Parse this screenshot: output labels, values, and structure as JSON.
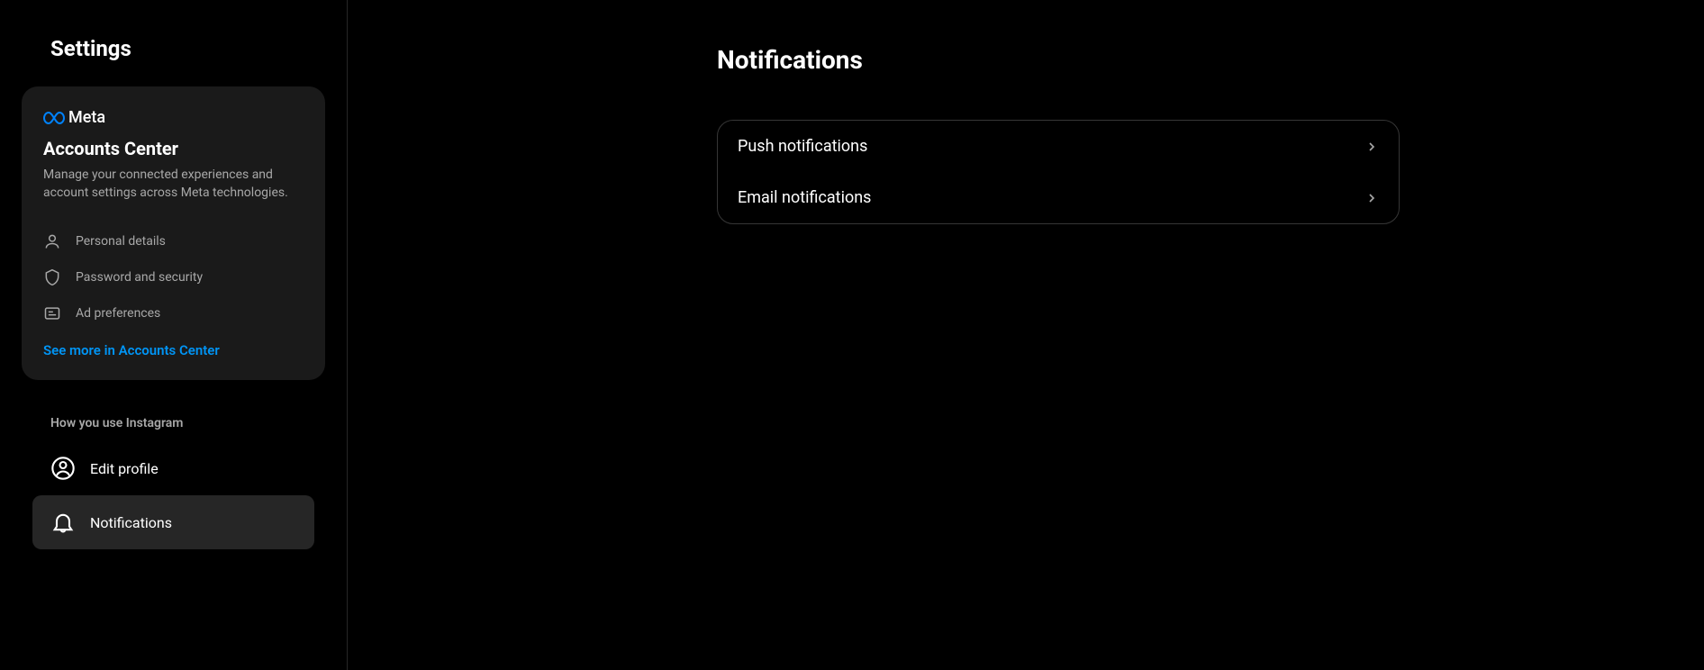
{
  "sidebar": {
    "title": "Settings",
    "accountsCenter": {
      "brand": "Meta",
      "title": "Accounts Center",
      "description": "Manage your connected experiences and account settings across Meta technologies.",
      "items": [
        {
          "label": "Personal details"
        },
        {
          "label": "Password and security"
        },
        {
          "label": "Ad preferences"
        }
      ],
      "link": "See more in Accounts Center"
    },
    "sectionHeader": "How you use Instagram",
    "nav": {
      "editProfile": "Edit profile",
      "notifications": "Notifications"
    }
  },
  "main": {
    "title": "Notifications",
    "options": {
      "push": "Push notifications",
      "email": "Email notifications"
    }
  }
}
